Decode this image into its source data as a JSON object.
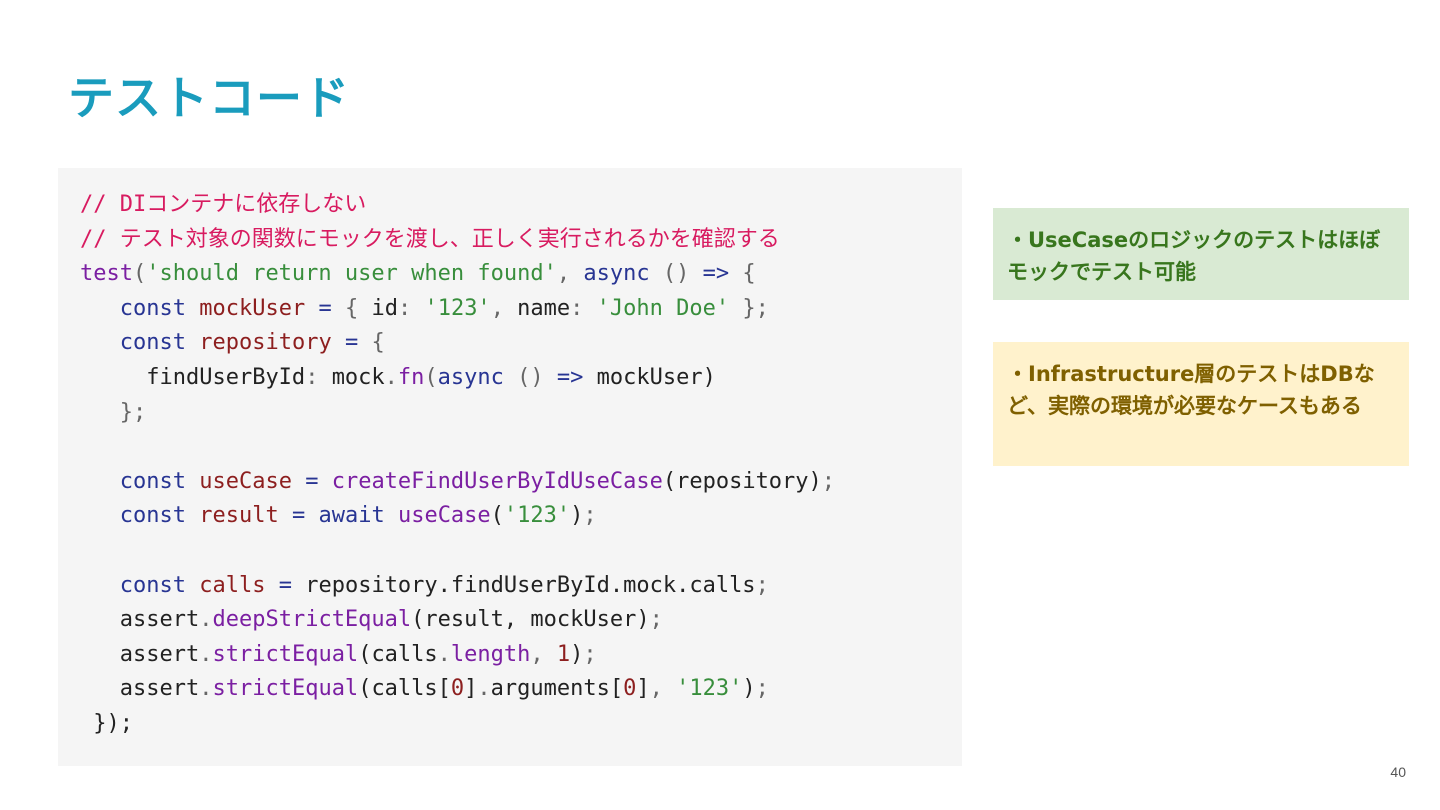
{
  "title": "テストコード",
  "code": {
    "comment1": "// DIコンテナに依存しない",
    "comment2": "// テスト対象の関数にモックを渡し、正しく実行されるかを確認する",
    "l3_test": "test",
    "l3_str": "'should return user when found'",
    "l3_async": "async",
    "l4_const": "const",
    "l4_var": "mockUser",
    "l4_str1": "'123'",
    "l4_str2": "'John Doe'",
    "l5_var": "repository",
    "l6_prop": "findUserById",
    "l6_obj": "mock",
    "l6_fn": "fn",
    "l8_var": "useCase",
    "l8_fn": "createFindUserByIdUseCase",
    "l8_arg": "repository",
    "l9_var": "result",
    "l9_await": "await",
    "l9_fn": "useCase",
    "l10_var": "calls",
    "l10_expr": "repository.findUserById.mock.calls",
    "assert": "assert",
    "m_deep": "deepStrictEqual",
    "m_strict": "strictEqual",
    "l11_args": "result, mockUser",
    "l12_calls": "calls",
    "l12_length": "length",
    "num1": "1",
    "num0": "0",
    "l13_arguments": "arguments",
    "close": "});"
  },
  "notes": {
    "usecase": "・UseCaseのロジックのテストはほぼモックでテスト可能",
    "infra": "・Infrastructure層のテストはDBなど、実際の環境が必要なケースもある"
  },
  "page_number": "40"
}
